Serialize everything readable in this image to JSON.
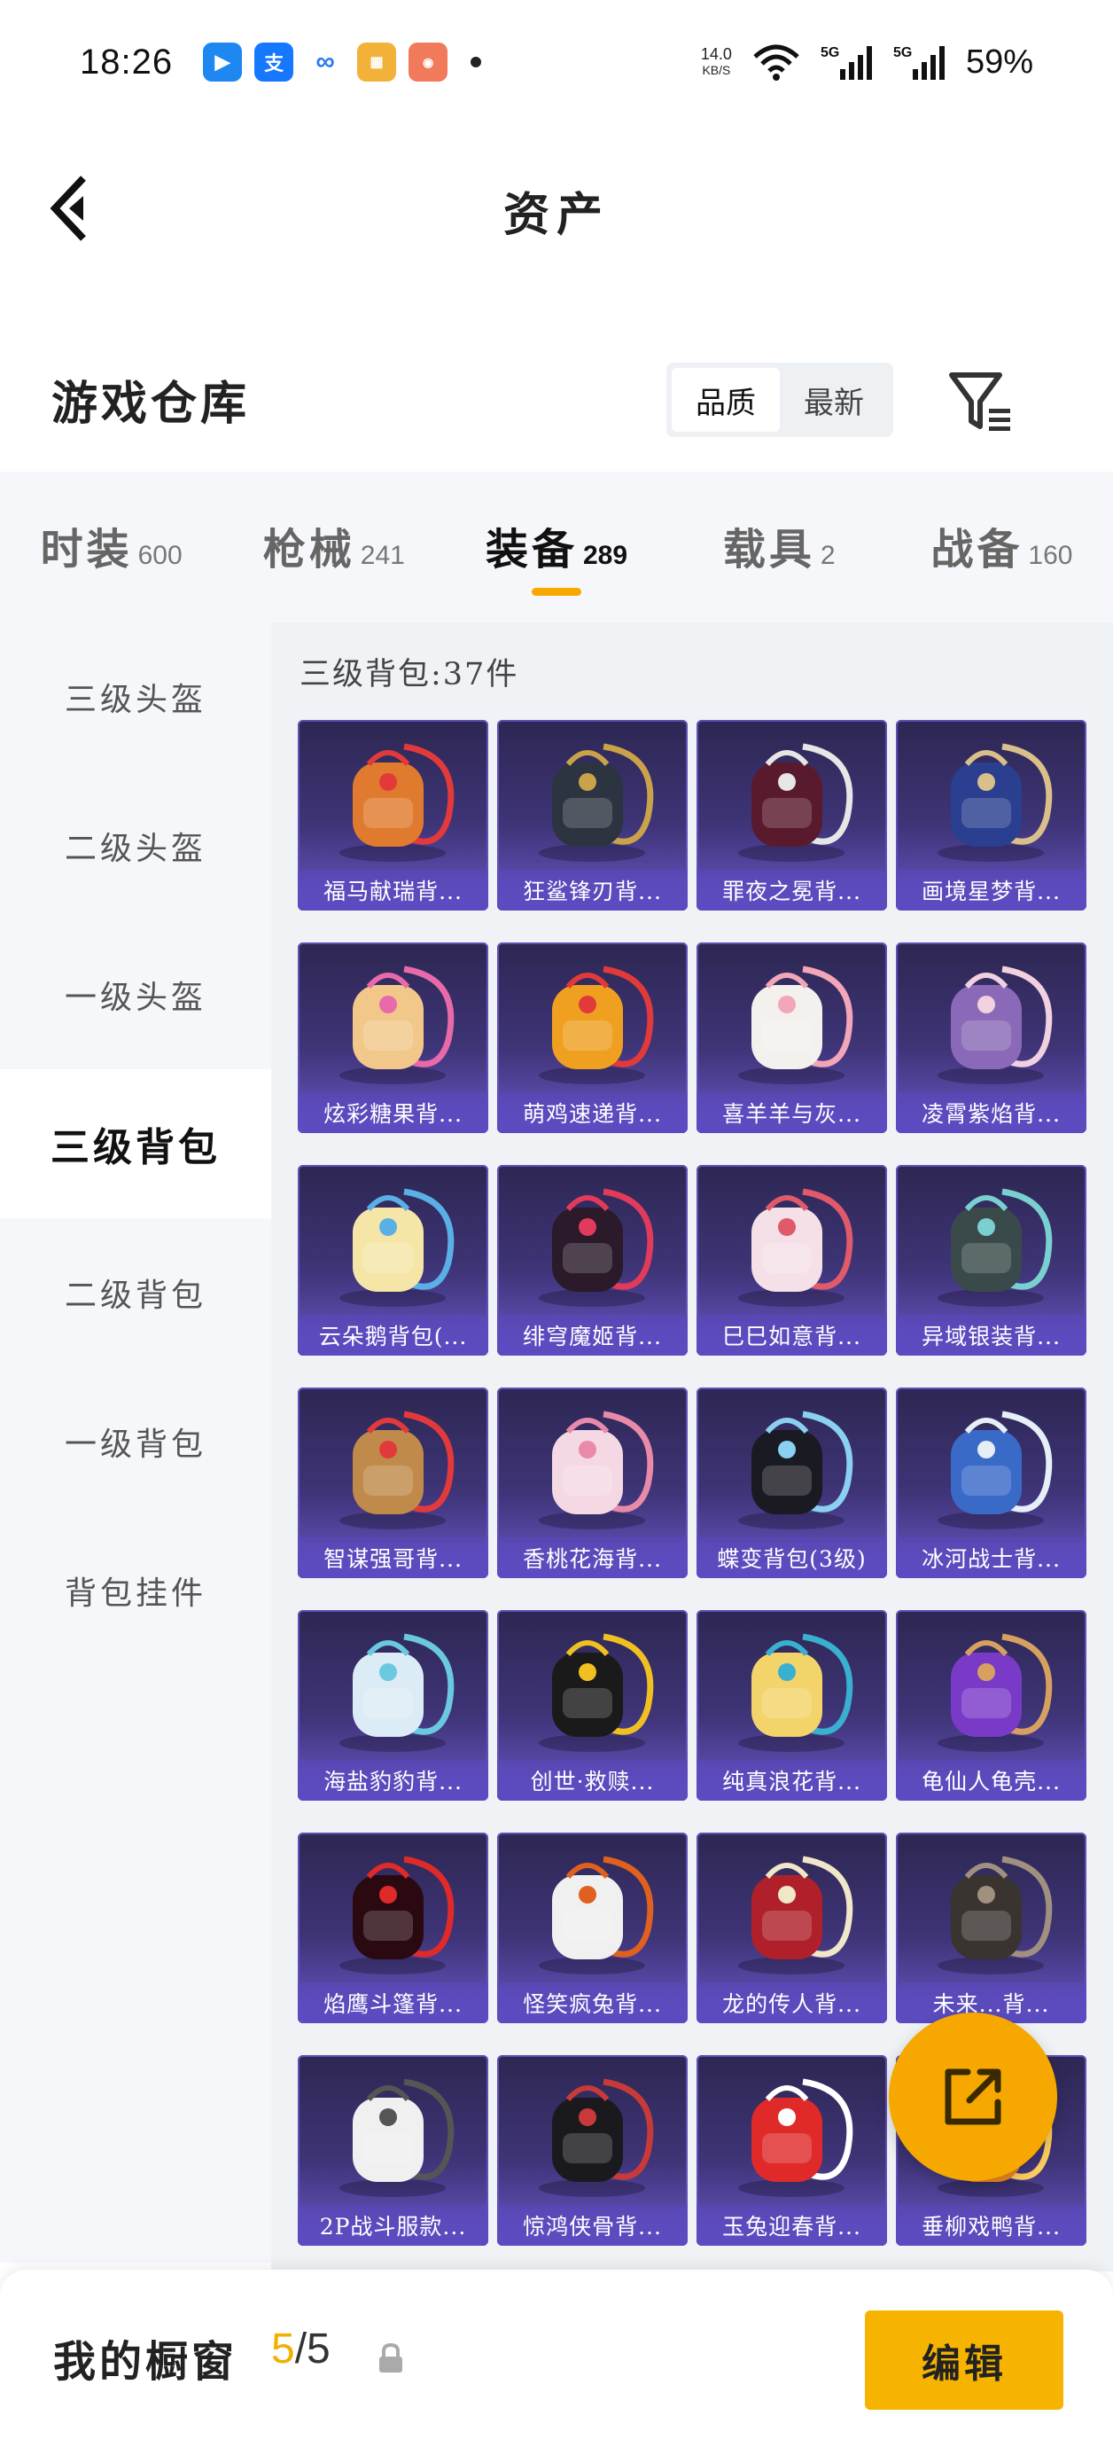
{
  "status_bar": {
    "time": "18:26",
    "net_speed_value": "14.0",
    "net_speed_unit": "KB/S",
    "network1": "5G",
    "network2": "5G",
    "battery": "59%",
    "apps": [
      "feishu-icon",
      "alipay-icon",
      "cloud-icon",
      "game-app-icon",
      "oppo-app-icon"
    ]
  },
  "nav": {
    "title": "资产"
  },
  "section": {
    "title": "游戏仓库",
    "sort_options": [
      "品质",
      "最新"
    ],
    "sort_active": 0
  },
  "category_tabs": [
    {
      "name": "时装",
      "count": "600"
    },
    {
      "name": "枪械",
      "count": "241"
    },
    {
      "name": "装备",
      "count": "289"
    },
    {
      "name": "载具",
      "count": "2"
    },
    {
      "name": "战备",
      "count": "160"
    }
  ],
  "active_category": 2,
  "sidebar": {
    "items": [
      "三级头盔",
      "二级头盔",
      "一级头盔",
      "三级背包",
      "二级背包",
      "一级背包",
      "背包挂件"
    ],
    "active": 3
  },
  "group": {
    "title": "三级背包:37件"
  },
  "items": [
    {
      "name": "福马献瑞背...",
      "color": "#e07a2e",
      "accent": "#e23a3a"
    },
    {
      "name": "狂鲨锋刃背...",
      "color": "#2b3440",
      "accent": "#c9a24a"
    },
    {
      "name": "罪夜之冕背...",
      "color": "#5a1a2e",
      "accent": "#e6e6e6"
    },
    {
      "name": "画境星梦背...",
      "color": "#2a3f8f",
      "accent": "#d9c08a"
    },
    {
      "name": "炫彩糖果背...",
      "color": "#f2c88a",
      "accent": "#e86aa8"
    },
    {
      "name": "萌鸡速递背...",
      "color": "#f0a020",
      "accent": "#e23a3a"
    },
    {
      "name": "喜羊羊与灰...",
      "color": "#f4f0ee",
      "accent": "#f2a6b8"
    },
    {
      "name": "凌霄紫焰背...",
      "color": "#8a6ab8",
      "accent": "#f2d0e0"
    },
    {
      "name": "云朵鹅背包(...",
      "color": "#f5e6a8",
      "accent": "#5ab0e6"
    },
    {
      "name": "绯穹魔姬背...",
      "color": "#2a1a2a",
      "accent": "#e23a5a"
    },
    {
      "name": "巳巳如意背...",
      "color": "#f4e0e6",
      "accent": "#e05a6a"
    },
    {
      "name": "异域银装背...",
      "color": "#3a4a4a",
      "accent": "#7ad0d0"
    },
    {
      "name": "智谋强哥背...",
      "color": "#c08a4a",
      "accent": "#e23a3a"
    },
    {
      "name": "香桃花海背...",
      "color": "#f4d8e4",
      "accent": "#e88aa8"
    },
    {
      "name": "蝶变背包(3级)",
      "color": "#1a1a22",
      "accent": "#8ad0f0"
    },
    {
      "name": "冰河战士背...",
      "color": "#3a6ac8",
      "accent": "#e6eef6"
    },
    {
      "name": "海盐豹豹背...",
      "color": "#dcecf6",
      "accent": "#6ac8e0"
    },
    {
      "name": "创世·救赎...",
      "color": "#1a1a1a",
      "accent": "#f0c020"
    },
    {
      "name": "纯真浪花背...",
      "color": "#f2d46a",
      "accent": "#3ab0d0"
    },
    {
      "name": "龟仙人龟壳...",
      "color": "#7a3ac8",
      "accent": "#d8a060"
    },
    {
      "name": "焰鹰斗篷背...",
      "color": "#2a0a10",
      "accent": "#e02a2a"
    },
    {
      "name": "怪笑疯兔背...",
      "color": "#f0f0f0",
      "accent": "#e06020"
    },
    {
      "name": "龙的传人背...",
      "color": "#b0202a",
      "accent": "#f0e6c8"
    },
    {
      "name": "未来...背...",
      "color": "#3a3430",
      "accent": "#a09080"
    },
    {
      "name": "2P战斗服款...",
      "color": "#f0f0f0",
      "accent": "#555555"
    },
    {
      "name": "惊鸿侠骨背...",
      "color": "#1a1a1e",
      "accent": "#c83a3a"
    },
    {
      "name": "玉兔迎春背...",
      "color": "#e02a2a",
      "accent": "#ffffff"
    },
    {
      "name": "垂柳戏鸭背...",
      "color": "#f08a20",
      "accent": "#ffd060"
    }
  ],
  "bottom": {
    "showcase_label": "我的橱窗",
    "showcase_current": "5",
    "showcase_total": "/5",
    "edit_label": "编辑"
  },
  "colors": {
    "accent": "#f6a800",
    "card_bg": "#3e3477",
    "label_bg": "#5a4bc0"
  }
}
